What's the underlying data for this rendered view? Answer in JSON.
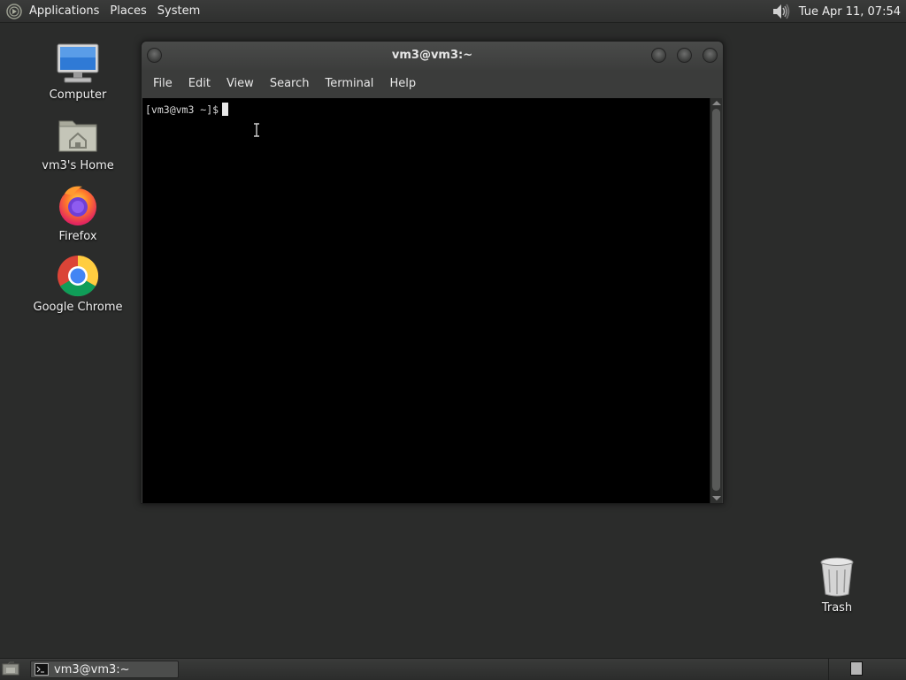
{
  "top_panel": {
    "menus": [
      "Applications",
      "Places",
      "System"
    ],
    "clock": "Tue Apr 11, 07:54"
  },
  "desktop": {
    "icons": [
      {
        "label": "Computer",
        "icon": "computer-icon"
      },
      {
        "label": "vm3's Home",
        "icon": "home-folder-icon"
      },
      {
        "label": "Firefox",
        "icon": "firefox-icon"
      },
      {
        "label": "Google Chrome",
        "icon": "chrome-icon"
      }
    ],
    "trash": {
      "label": "Trash",
      "icon": "trash-icon"
    }
  },
  "terminal": {
    "title": "vm3@vm3:~",
    "menus": [
      "File",
      "Edit",
      "View",
      "Search",
      "Terminal",
      "Help"
    ],
    "prompt": "[vm3@vm3 ~]$"
  },
  "bottom_panel": {
    "task_label": "vm3@vm3:~"
  },
  "colors": {
    "desktop_bg": "#2b2c2b",
    "terminal_bg": "#000000",
    "panel_bg": "#353635"
  }
}
